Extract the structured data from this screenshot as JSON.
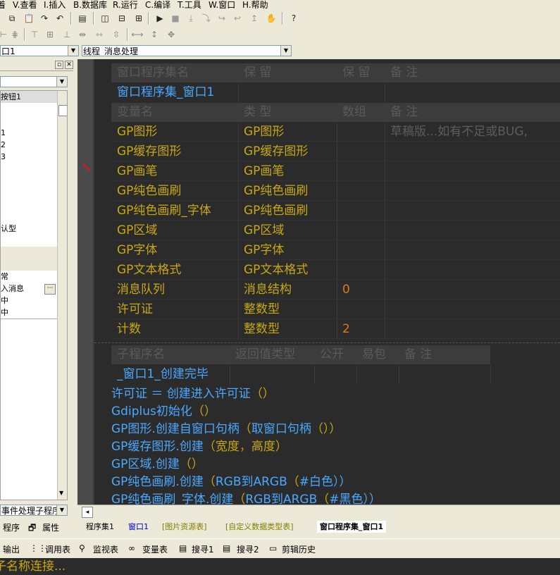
{
  "menu": {
    "items": [
      "着",
      "V.查看",
      "I.插入",
      "B.数据库",
      "R.运行",
      "C.编译",
      "T.工具",
      "W.窗口",
      "H.帮助"
    ]
  },
  "combos": {
    "left_value": "口1",
    "right_value": "线程_消息处理",
    "props_combo": "事件处理子程序"
  },
  "left_panel": {
    "rows": [
      "按钮1",
      "",
      "",
      "1",
      "2",
      "3",
      "",
      "",
      "",
      "",
      "",
      "认型",
      "",
      "",
      "",
      "",
      "",
      "",
      ""
    ],
    "rows2": [
      "常",
      "入消息",
      "中",
      "中"
    ],
    "tab_program": "程序",
    "tab_props": "属性"
  },
  "assembly_table": {
    "headers": [
      "窗口程序集名",
      "保 留",
      "保 留",
      "备 注"
    ],
    "name": "窗口程序集_窗口1"
  },
  "var_table": {
    "headers": [
      "变量名",
      "类 型",
      "数组",
      "备 注"
    ],
    "rows": [
      {
        "name": "GP图形",
        "type": "GP图形",
        "array": "",
        "note": "草稿版...如有不足或BUG,"
      },
      {
        "name": "GP缓存图形",
        "type": "GP缓存图形",
        "array": "",
        "note": ""
      },
      {
        "name": "GP画笔",
        "type": "GP画笔",
        "array": "",
        "note": ""
      },
      {
        "name": "GP纯色画刷",
        "type": "GP纯色画刷",
        "array": "",
        "note": ""
      },
      {
        "name": "GP纯色画刷_字体",
        "type": "GP纯色画刷",
        "array": "",
        "note": ""
      },
      {
        "name": "GP区域",
        "type": "GP区域",
        "array": "",
        "note": ""
      },
      {
        "name": "GP字体",
        "type": "GP字体",
        "array": "",
        "note": ""
      },
      {
        "name": "GP文本格式",
        "type": "GP文本格式",
        "array": "",
        "note": ""
      },
      {
        "name": "消息队列",
        "type": "消息结构",
        "array": "0",
        "note": ""
      },
      {
        "name": "许可证",
        "type": "整数型",
        "array": "",
        "note": ""
      },
      {
        "name": "计数",
        "type": "整数型",
        "array": "2",
        "note": ""
      }
    ]
  },
  "sub_table": {
    "headers": [
      "子程序名",
      "返回值类型",
      "公开",
      "易包",
      "备 注"
    ],
    "name": "_窗口1_创建完毕"
  },
  "code_lines": [
    [
      "许可证",
      " ＝ ",
      "创建进入许可证",
      "（）"
    ],
    [
      "Gdiplus初始化",
      "（）"
    ],
    [
      "GP图形",
      ".",
      "创建自窗口句柄",
      "（",
      "取窗口句柄",
      "（））"
    ],
    [
      "GP缓存图形",
      ".",
      "创建",
      "（",
      "宽度",
      "，",
      "高度",
      "）"
    ],
    [
      "GP区域",
      ".",
      "创建",
      "（）"
    ],
    [
      "GP纯色画刷",
      ".",
      "创建",
      "（",
      "RGB到ARGB",
      "（",
      "#白色",
      "））"
    ],
    [
      "GP纯色画刷_字体",
      ".",
      "创建",
      "（",
      "RGB到ARGB",
      "（",
      "#黑色",
      "））"
    ]
  ],
  "tabs": [
    "程序集1",
    "窗口1",
    "[图片资源表]",
    "[自定义数据类型表]",
    "窗口程序集_窗口1"
  ],
  "bottom_tabs": [
    "输出",
    "调用表",
    "监视表",
    "变量表",
    "搜寻1",
    "搜寻2",
    "剪辑历史"
  ],
  "output_text": "子名称连接...",
  "colors": {
    "code_bg": "#2b2b2b",
    "keyword_yellow": "#c8a810",
    "keyword_blue": "#4aa8ff",
    "number_orange": "#e07818"
  }
}
